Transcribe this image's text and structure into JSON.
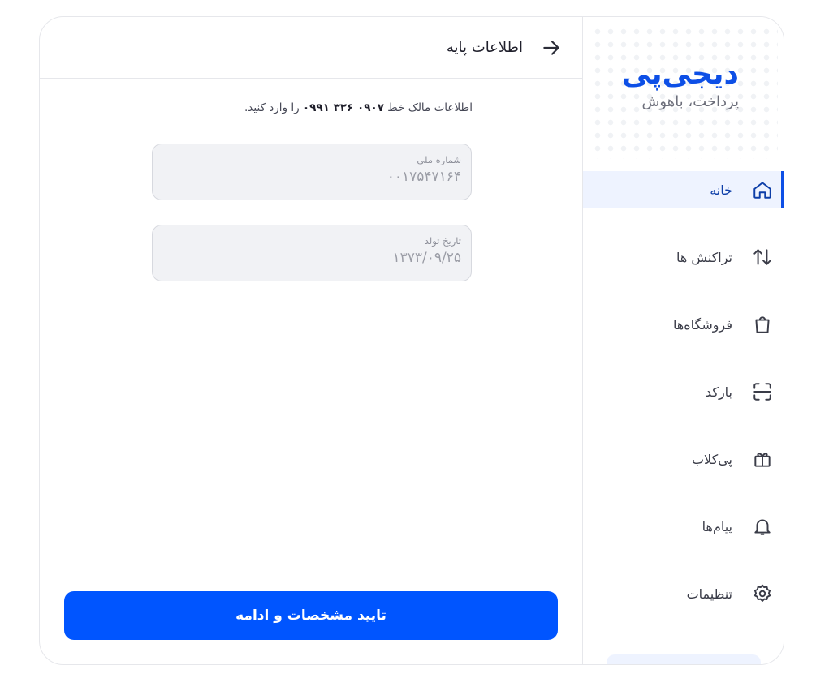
{
  "brand": {
    "name": "دیجی‌پی",
    "tagline": "پرداخت، باهوش",
    "color": "#0d4fe6"
  },
  "sidebar": {
    "items": [
      {
        "label": "خانه",
        "icon": "home-icon",
        "active": true
      },
      {
        "label": "تراکنش ها",
        "icon": "transactions-icon",
        "active": false
      },
      {
        "label": "فروشگاه‌ها",
        "icon": "shopping-bag-icon",
        "active": false
      },
      {
        "label": "بارکد",
        "icon": "scan-icon",
        "active": false
      },
      {
        "label": "پی‌کلاب",
        "icon": "gift-icon",
        "active": false
      },
      {
        "label": "پیام‌ها",
        "icon": "bell-icon",
        "active": false
      },
      {
        "label": "تنظیمات",
        "icon": "gear-icon",
        "active": false
      }
    ]
  },
  "header": {
    "title": "اطلاعات پایه",
    "back_icon": "arrow-right-icon"
  },
  "instruction": {
    "prefix": "اطلاعات مالک خط",
    "phone": "۰۹۰۷ ۳۲۶ ۰۹۹۱",
    "suffix": "را وارد کنید."
  },
  "form": {
    "national_id": {
      "label": "شماره ملی",
      "value": "۰۰۱۷۵۴۷۱۶۴"
    },
    "birth_date": {
      "label": "تاریخ تولد",
      "value": "۱۳۷۳/۰۹/۲۵"
    }
  },
  "actions": {
    "confirm_label": "تایید مشخصات و ادامه",
    "primary_color": "#0055ff"
  }
}
